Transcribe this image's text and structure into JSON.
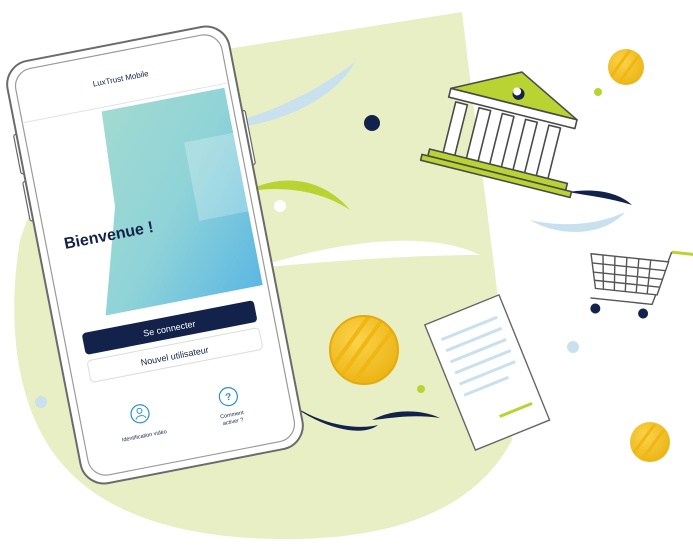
{
  "app": {
    "title": "LuxTrust Mobile",
    "welcome": "Bienvenue !",
    "buttons": {
      "connect": "Se connecter",
      "new_user": "Nouvel utilisateur"
    },
    "shortcuts": {
      "video_id": "Identification vidéo",
      "how_to_line1": "Comment",
      "how_to_line2": "activer ?",
      "help_glyph": "?"
    }
  },
  "colors": {
    "background_blob": "#e8efc4",
    "accent_green": "#b9d432",
    "navy": "#13224a",
    "coin": "#f5bf1e",
    "light_blue": "#c9e1ee",
    "teal": "#7dcfd2"
  },
  "icons": [
    "bank-icon",
    "shopping-cart-icon",
    "document-icon",
    "coin-icon",
    "video-identification-icon",
    "help-icon"
  ]
}
